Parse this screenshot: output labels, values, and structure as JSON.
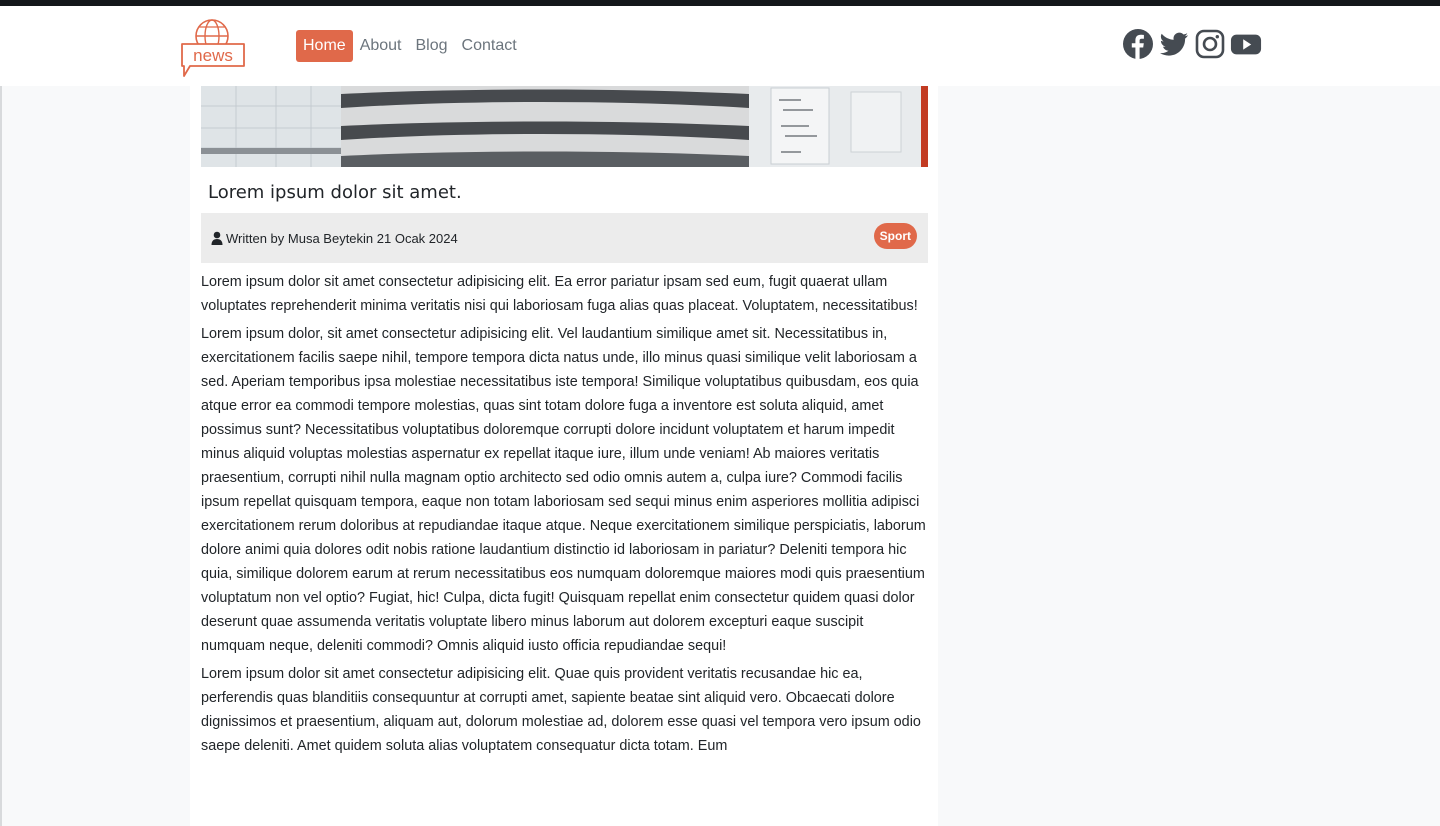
{
  "nav": {
    "logo_text": "news",
    "links": [
      {
        "label": "Home",
        "active": true
      },
      {
        "label": "About",
        "active": false
      },
      {
        "label": "Blog",
        "active": false
      },
      {
        "label": "Contact",
        "active": false
      }
    ],
    "socials": [
      "facebook-icon",
      "twitter-icon",
      "instagram-icon",
      "youtube-icon"
    ]
  },
  "article": {
    "title": "Lorem ipsum dolor sit amet.",
    "meta": {
      "author_line": "Written by Musa Beytekin 21 Ocak 2024",
      "category": "Sport"
    },
    "paragraphs": [
      "Lorem ipsum dolor sit amet consectetur adipisicing elit. Ea error pariatur ipsam sed eum, fugit quaerat ullam voluptates reprehenderit minima veritatis nisi qui laboriosam fuga alias quas placeat. Voluptatem, necessitatibus!",
      "Lorem ipsum dolor, sit amet consectetur adipisicing elit. Vel laudantium similique amet sit. Necessitatibus in, exercitationem facilis saepe nihil, tempore tempora dicta natus unde, illo minus quasi similique velit laboriosam a sed. Aperiam temporibus ipsa molestiae necessitatibus iste tempora! Similique voluptatibus quibusdam, eos quia atque error ea commodi tempore molestias, quas sint totam dolore fuga a inventore est soluta aliquid, amet possimus sunt? Necessitatibus voluptatibus doloremque corrupti dolore incidunt voluptatem et harum impedit minus aliquid voluptas molestias aspernatur ex repellat itaque iure, illum unde veniam! Ab maiores veritatis praesentium, corrupti nihil nulla magnam optio architecto sed odio omnis autem a, culpa iure? Commodi facilis ipsum repellat quisquam tempora, eaque non totam laboriosam sed sequi minus enim asperiores mollitia adipisci exercitationem rerum doloribus at repudiandae itaque atque. Neque exercitationem similique perspiciatis, laborum dolore animi quia dolores odit nobis ratione laudantium distinctio id laboriosam in pariatur? Deleniti tempora hic quia, similique dolorem earum at rerum necessitatibus eos numquam doloremque maiores modi quis praesentium voluptatum non vel optio? Fugiat, hic! Culpa, dicta fugit! Quisquam repellat enim consectetur quidem quasi dolor deserunt quae assumenda veritatis voluptate libero minus laborum aut dolorem excepturi eaque suscipit numquam neque, deleniti commodi? Omnis aliquid iusto officia repudiandae sequi!",
      "Lorem ipsum dolor sit amet consectetur adipisicing elit. Quae quis provident veritatis recusandae hic ea, perferendis quas blanditiis consequuntur at corrupti amet, sapiente beatae sint aliquid vero. Obcaecati dolore dignissimos et praesentium, aliquam aut, dolorum molestiae ad, dolorem esse quasi vel tempora vero ipsum odio saepe deleniti. Amet quidem soluta alias voluptatem consequatur dicta totam. Eum"
    ]
  },
  "colors": {
    "accent": "#e0694a",
    "topbar": "#14171a",
    "meta_bg": "#ececec"
  }
}
